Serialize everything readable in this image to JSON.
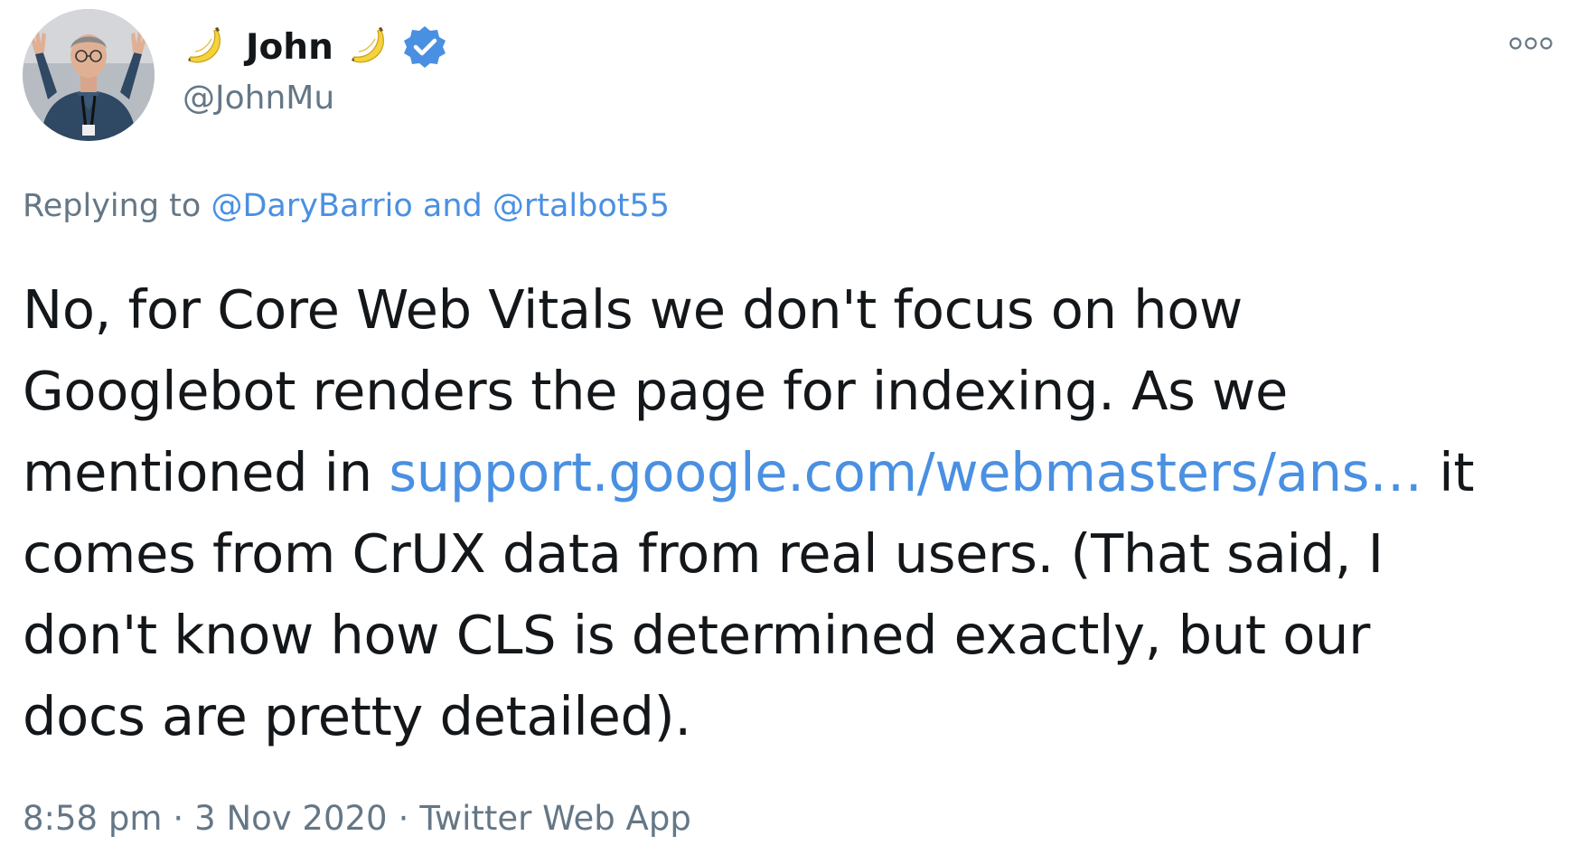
{
  "author": {
    "display_name": "John",
    "handle": "@JohnMu",
    "name_emoji": "banana-icon",
    "verified": true,
    "verified_color": "#4a90e2"
  },
  "reply": {
    "prefix": "Replying to",
    "mention1": "@DaryBarrio",
    "conjunction": "and",
    "mention2": "@rtalbot55"
  },
  "body": {
    "line1": "No, for Core Web Vitals we don't focus on how",
    "line2": "Googlebot renders the page for indexing. As we",
    "line3_before": "mentioned in",
    "line3_link": "support.google.com/webmasters/ans…",
    "line3_after": "it",
    "line4": "comes from CrUX data from real users. (That said, I",
    "line5": "don't know how CLS is determined exactly, but our",
    "line6": "docs are pretty detailed)."
  },
  "meta": {
    "time": "8:58 pm",
    "separator": "·",
    "date": "3 Nov 2020",
    "source": "Twitter Web App"
  },
  "colors": {
    "link": "#4a90e2",
    "secondary_text": "#657786",
    "primary_text": "#14171a"
  }
}
